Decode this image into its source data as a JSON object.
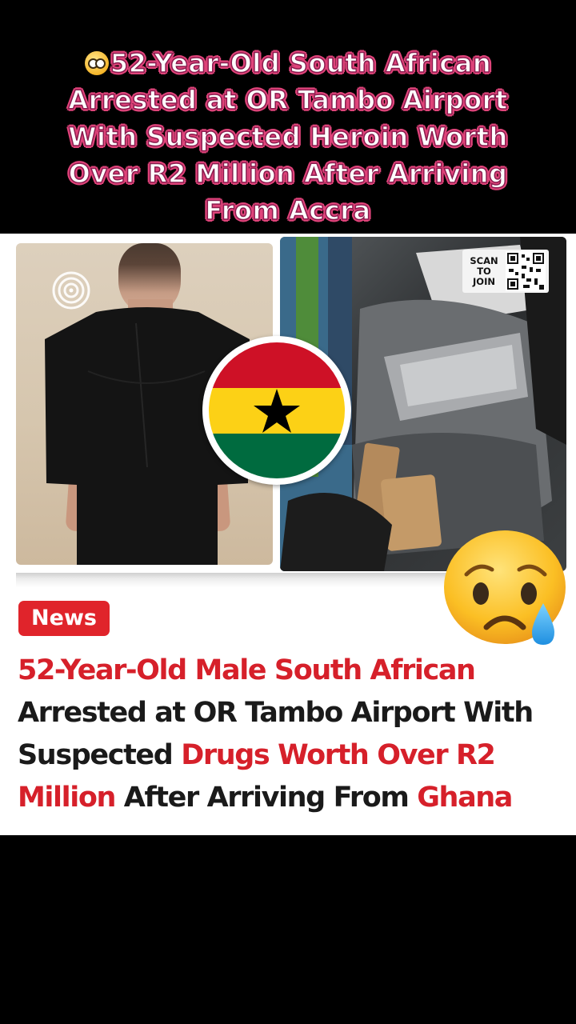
{
  "overlay": {
    "emoji_icon": "nerd-face-emoji",
    "title": "52-Year-Old South African Arrested at OR Tambo Airport With Suspected Heroin Worth Over R2 Million After Arriving From Accra"
  },
  "card": {
    "left_photo": {
      "logo_icon": "swirl-logo-icon"
    },
    "right_photo": {
      "scan_line1": "SCAN",
      "scan_line2": "TO",
      "scan_line3": "JOIN",
      "qr_icon": "qr-code-icon"
    },
    "flag_icon": "ghana-flag-icon",
    "reaction_icon": "sad-but-relieved-face-emoji",
    "badge": "News",
    "headline": {
      "part1": "52-Year-Old Male South African",
      "part2": "Arrested at OR Tambo Airport With Suspected ",
      "part3": "Drugs Worth Over R2 Million",
      "part4": " After Arriving From ",
      "part5": "Ghana"
    }
  },
  "colors": {
    "accent_red": "#d6202a",
    "badge_red": "#e0242b",
    "title_outline": "#e0457b",
    "flag_red": "#ce1126",
    "flag_yellow": "#fcd116",
    "flag_green": "#006b3f"
  }
}
